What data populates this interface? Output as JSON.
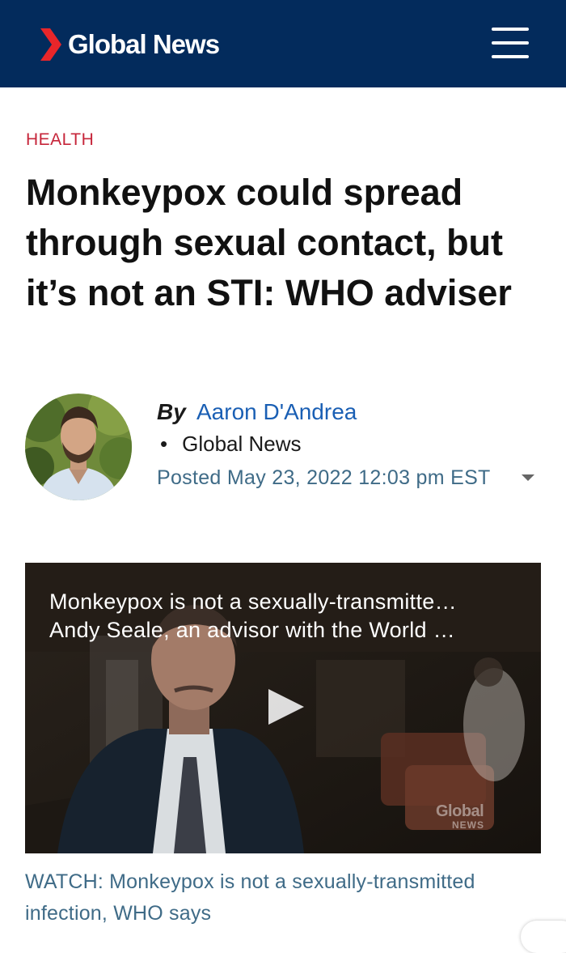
{
  "header": {
    "brand": "Global News",
    "brand_color": "#032b5c",
    "logo_icon": "global-news-chevron-icon",
    "menu_icon": "hamburger-menu-icon"
  },
  "article": {
    "category": "HEALTH",
    "headline": "Monkeypox could spread through sexual contact, but it’s not an STI: WHO adviser",
    "byline": {
      "by": "By",
      "author": "Aaron D'Andrea",
      "separator": "•",
      "source": "Global News",
      "posted": "Posted May 23, 2022 12:03 pm EST"
    }
  },
  "video": {
    "title_line1": "Monkeypox is not a sexually-transmitte…",
    "title_line2": "Andy Seale, an advisor with the World …",
    "watermark_line1": "Global",
    "watermark_line2": "NEWS",
    "play_icon": "play-icon",
    "caption": "WATCH: Monkeypox is not a sexually-transmitted infection, WHO says"
  },
  "colors": {
    "category": "#c6253a",
    "author_link": "#1a5fb4",
    "meta_text": "#3f6b87"
  }
}
